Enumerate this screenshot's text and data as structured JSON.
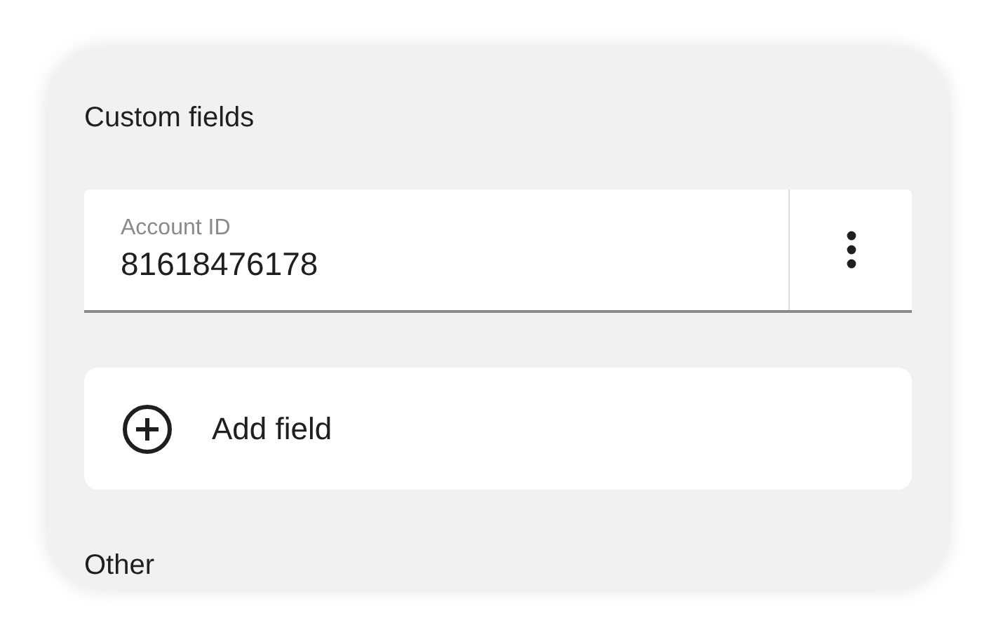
{
  "sections": [
    {
      "heading": "Custom fields"
    },
    {
      "heading": "Other"
    }
  ],
  "custom_fields": [
    {
      "label": "Account ID",
      "value": "81618476178"
    }
  ],
  "add_button": {
    "label": "Add field"
  }
}
